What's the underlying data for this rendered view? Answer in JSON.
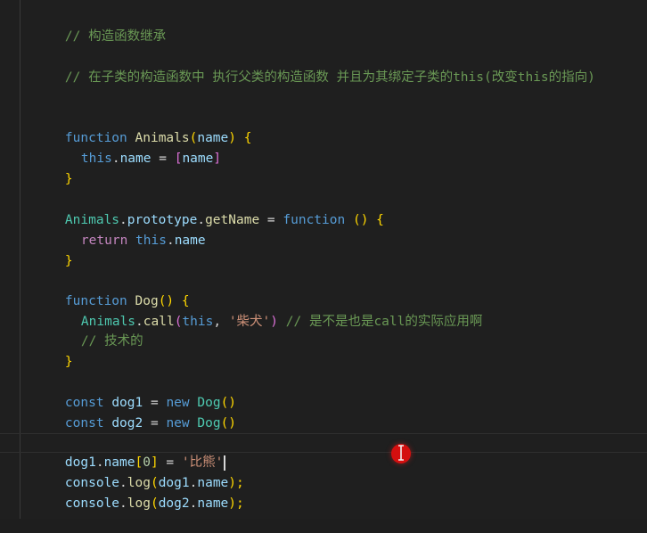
{
  "editor": {
    "language": "javascript",
    "current_line_index": 16,
    "lines": [
      {
        "id": "l1",
        "tokens": [
          "// 构造函数继承"
        ]
      },
      {
        "id": "l2",
        "tokens": [
          "// 在子类的构造函数中 执行父类的构造函数 并且为其绑定子类的this(改变this的指向)"
        ]
      },
      {
        "id": "l3",
        "tokens": [
          "function",
          " ",
          "Animals",
          "(",
          "name",
          ") ",
          "{"
        ]
      },
      {
        "id": "l4",
        "tokens": [
          "this",
          ".",
          "name",
          " = ",
          "[",
          "name",
          "]"
        ]
      },
      {
        "id": "l5",
        "tokens": [
          "}"
        ]
      },
      {
        "id": "l6",
        "tokens": [
          "Animals",
          ".",
          "prototype",
          ".",
          "getName",
          " = ",
          "function",
          " ",
          "()",
          " ",
          "{"
        ]
      },
      {
        "id": "l7",
        "tokens": [
          "return",
          " ",
          "this",
          ".",
          "name"
        ]
      },
      {
        "id": "l8",
        "tokens": [
          "}"
        ]
      },
      {
        "id": "l9",
        "tokens": [
          "function",
          " ",
          "Dog",
          "()",
          " ",
          "{"
        ]
      },
      {
        "id": "l10",
        "tokens": [
          "Animals",
          ".",
          "call",
          "(",
          "this",
          ", ",
          "'柴犬'",
          ")",
          " ",
          "// 是不是也是call的实际应用啊"
        ]
      },
      {
        "id": "l11",
        "tokens": [
          "// 技术的"
        ]
      },
      {
        "id": "l12",
        "tokens": [
          "}"
        ]
      },
      {
        "id": "l13",
        "tokens": [
          "const",
          " ",
          "dog1",
          " = ",
          "new",
          " ",
          "Dog",
          "()"
        ]
      },
      {
        "id": "l14",
        "tokens": [
          "const",
          " ",
          "dog2",
          " = ",
          "new",
          " ",
          "Dog",
          "()"
        ]
      },
      {
        "id": "l15",
        "tokens": [
          "dog1",
          ".",
          "name",
          "[",
          "0",
          "]",
          " = ",
          "'比熊'"
        ]
      },
      {
        "id": "l16",
        "tokens": [
          "console",
          ".",
          "log",
          "(",
          "dog1",
          ".",
          "name",
          ");"
        ]
      },
      {
        "id": "l17",
        "tokens": [
          "console",
          ".",
          "log",
          "(",
          "dog2",
          ".",
          "name",
          ");"
        ]
      }
    ]
  },
  "colors": {
    "background": "#1f1f1f",
    "comment": "#6a9955",
    "keyword": "#569cd6",
    "control_keyword": "#c586c0",
    "class_name": "#4ec9b0",
    "function_name": "#dcdcaa",
    "variable": "#9cdcfe",
    "string": "#ce9178",
    "number": "#b5cea8",
    "mouse_indicator": "#d40f0f"
  },
  "icons": {
    "mouse_indicator": "mouse-click-indicator-icon",
    "text_cursor": "i-beam-cursor-icon"
  }
}
